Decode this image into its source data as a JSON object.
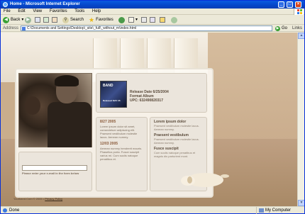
{
  "window": {
    "title": "Home - Microsoft Internet Explorer",
    "min": "_",
    "max": "□",
    "close": "×"
  },
  "menu": [
    "File",
    "Edit",
    "View",
    "Favorites",
    "Tools",
    "Help"
  ],
  "toolbar": {
    "back": "Back",
    "search": "Search",
    "favorites": "Favorites"
  },
  "address": {
    "label": "Address",
    "url": "C:\\Documents and Settings\\Desktop\\_site\\_full\\_without_m\\index.html",
    "go": "Go",
    "links": "Links"
  },
  "site": {
    "release": {
      "album_title": "BAND",
      "album_subtitle": "Released MAY 26",
      "date": "Release Date 6/25/2004",
      "format": "Format Album",
      "upc": "UPC: 632490820317"
    },
    "news": [
      {
        "date": "8/27 2005",
        "text": "Lorem ipsum dolor sit amet, consectetuer adipiscing elit. Praesent vestibulum molestie lacus. Aenean nummy."
      },
      {
        "date": "12/03 2005",
        "text": "Aenean nummy hendrerit mauris. Phasellus porta. Fusce suscipit varius mi. Cum sociis natoque penatibus et."
      }
    ],
    "side": [
      {
        "heading": "Lorem ipsum dolor",
        "text": "Praesent vestibulum molestie lacus. Aenean nummy."
      },
      {
        "heading": "Praesent vestibulum",
        "text": "Praesent vestibulum molestie lacus. Aenean nummy."
      },
      {
        "heading": "Fusce suscipit",
        "text": "Cum sociis natoque penatibus et magnis dis parturient mont."
      }
    ],
    "mail": {
      "placeholder": "",
      "caption": "Please enter your e-mail in the form below"
    },
    "footer": {
      "copyright": "Yourband.Com © 2005 •",
      "privacy": "Privacy Policy"
    }
  },
  "status": {
    "text": "Done",
    "zone": "My Computer"
  },
  "colors": {
    "titlebar": "#0546c8",
    "panel_bg": "#ebe5dc",
    "accent_brown": "#8a5a3a"
  }
}
